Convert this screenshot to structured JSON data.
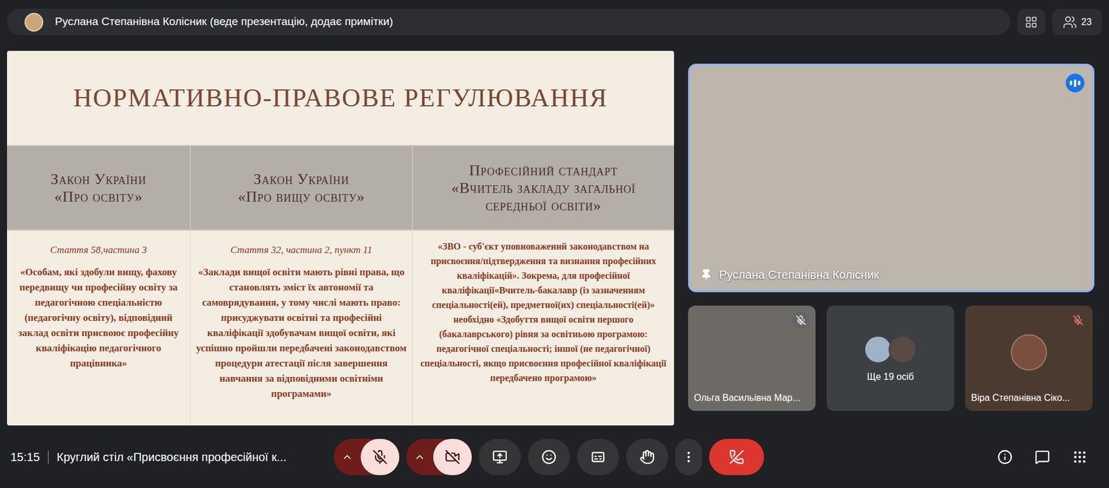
{
  "top_bar": {
    "presenter": "Руслана Степанівна Колісник (веде презентацію, додає примітки)",
    "participants_count": "23"
  },
  "slide": {
    "title": "НОРМАТИВНО-ПРАВОВЕ РЕГУЛЮВАННЯ",
    "columns": [
      {
        "heading": [
          "Закон України",
          "«Про освіту»"
        ],
        "label": "Стаття 58,частина 3",
        "text": "«Особам, які здобули вищу, фахову передвищу чи професійну освіту за педагогічною спеціальністю (педагогічну освіту), відповідний заклад освіти присвоює професійну кваліфікацію педагогічного працівника»"
      },
      {
        "heading": [
          "Закон України",
          "«Про вищу освіту»"
        ],
        "label": "Стаття 32, частина 2, пункт 11",
        "text": "«Заклади вищої освіти мають рівні права, що становлять зміст їх автономії та самоврядування, у тому числі мають право: присуджувати освітні та професійні кваліфікації здобувачам вищої освіти, які успішно пройшли передбачені законодавством процедури атестації після завершення навчання за відповідними освітніми програмами»"
      },
      {
        "heading": [
          "Професійний стандарт",
          "«Вчитель закладу загальної",
          "середньої освіти»"
        ],
        "text": "«ЗВО - суб'єкт уповноважений законодавством на присвоєння/підтвердження та визнання професійних кваліфікацій». Зокрема, для професійної кваліфікації«Вчитель-бакалавр (із зазначенням спеціальності(ей), предметної(их) спеціальності(ей)» необхідно «Здобуття вищої освіти першого (бакалаврського) рівня за освітньою програмою: педагогічної спеціальності; іншої (не педагогічної) спеціальності, якщо присвоєння професійної кваліфікації передбачено програмою»"
      }
    ]
  },
  "tiles": {
    "main": {
      "name": "Руслана Степанівна Колісник",
      "pinned": true,
      "speaking": true
    },
    "small": [
      {
        "kind": "video",
        "name": "Ольга Васильівна Мар...",
        "muted": true
      },
      {
        "kind": "group",
        "name": "Ще 19 осіб",
        "muted": false
      },
      {
        "kind": "avatar",
        "name": "Віра Степанівна Сіко...",
        "muted": true
      }
    ]
  },
  "bottom_bar": {
    "time": "15:15",
    "meeting_title": "Круглий стіл «Присвоєння професійної к...",
    "mic_muted": true,
    "camera_off": true
  }
}
